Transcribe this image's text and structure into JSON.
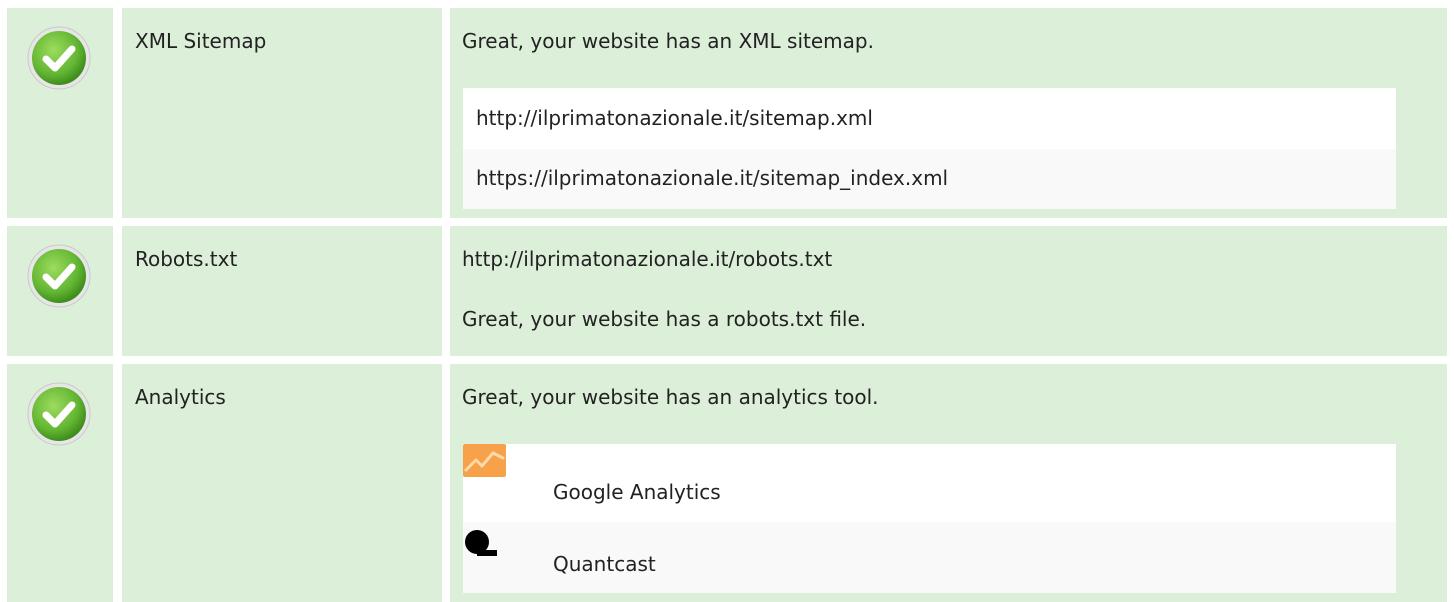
{
  "rows": [
    {
      "label": "XML Sitemap",
      "status_icon": "check-icon",
      "message": "Great, your website has an XML sitemap.",
      "items": [
        "http://ilprimatonazionale.it/sitemap.xml",
        "https://ilprimatonazionale.it/sitemap_index.xml"
      ]
    },
    {
      "label": "Robots.txt",
      "status_icon": "check-icon",
      "url": "http://ilprimatonazionale.it/robots.txt",
      "message": "Great, your website has a robots.txt file."
    },
    {
      "label": "Analytics",
      "status_icon": "check-icon",
      "message": "Great, your website has an analytics tool.",
      "tools": [
        {
          "name": "Google Analytics",
          "icon": "google-analytics-icon"
        },
        {
          "name": "Quantcast",
          "icon": "quantcast-icon"
        }
      ]
    }
  ],
  "colors": {
    "row_background": "#dcefd9",
    "check_green": "#6cbf3a",
    "analytics_orange": "#f7a14a"
  }
}
